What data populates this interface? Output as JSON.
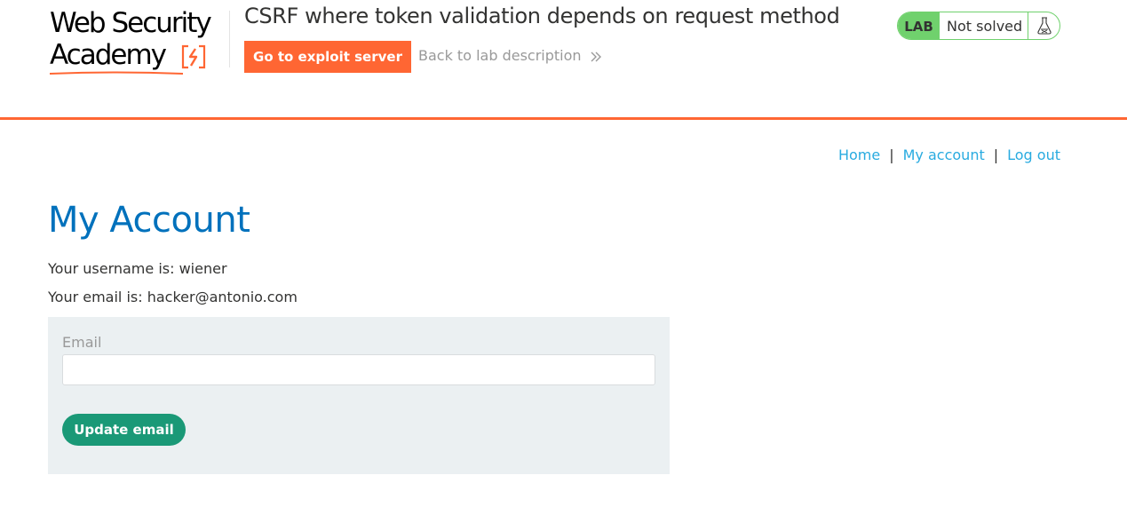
{
  "header": {
    "logo": {
      "line1": "Web Security",
      "line2": "Academy"
    },
    "lab_title": "CSRF where token validation depends on request method",
    "exploit_button_label": "Go to exploit server",
    "back_link_label": "Back to lab description",
    "lab_status": {
      "badge": "LAB",
      "status": "Not solved"
    }
  },
  "nav": {
    "home": "Home",
    "separator": "|",
    "my_account": "My account",
    "log_out": "Log out"
  },
  "main": {
    "title": "My Account",
    "username_line": "Your username is: wiener",
    "email_line": "Your email is: hacker@antonio.com",
    "form": {
      "email_label": "Email",
      "email_value": "",
      "submit_label": "Update email"
    }
  },
  "colors": {
    "accent_orange": "#ff6633",
    "title_blue": "#0071bc",
    "link_blue": "#29abe0",
    "status_green": "#70d16d",
    "button_green": "#1a9977",
    "panel_bg": "#ebf0f2"
  },
  "icons": {
    "logo_mark": "lightning-bolt-bracket-icon",
    "back_chevron": "double-chevron-right-icon",
    "lab_status_icon": "flask-icon"
  }
}
